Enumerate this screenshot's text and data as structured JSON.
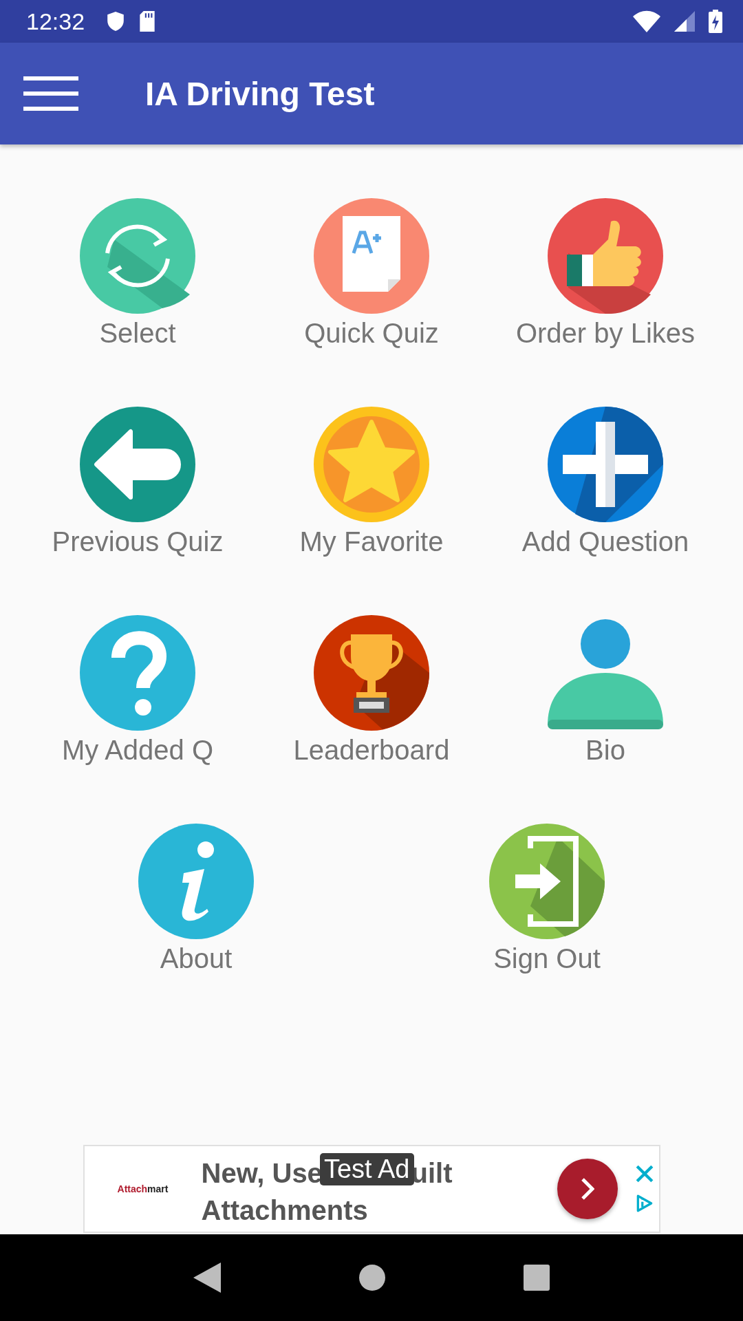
{
  "status_bar": {
    "time": "12:32"
  },
  "app_bar": {
    "title": "IA Driving Test"
  },
  "rows": [
    [
      {
        "label": "Select",
        "kind": "sync"
      },
      {
        "label": "Quick Quiz",
        "kind": "grade"
      },
      {
        "label": "Order by Likes",
        "kind": "thumb"
      }
    ],
    [
      {
        "label": "Previous Quiz",
        "kind": "back"
      },
      {
        "label": "My Favorite",
        "kind": "star"
      },
      {
        "label": "Add Question",
        "kind": "plus"
      }
    ],
    [
      {
        "label": "My Added Q",
        "kind": "question"
      },
      {
        "label": "Leaderboard",
        "kind": "trophy"
      },
      {
        "label": "Bio",
        "kind": "person"
      }
    ],
    [
      {
        "label": "About",
        "kind": "info"
      },
      {
        "label": "Sign Out",
        "kind": "exit"
      }
    ]
  ],
  "ad": {
    "logo_parts": [
      "Attach",
      "mart"
    ],
    "headline_line1_parts": [
      "New, Use",
      "uilt"
    ],
    "headline_line2": "Attachments",
    "badge": "Test Ad"
  }
}
